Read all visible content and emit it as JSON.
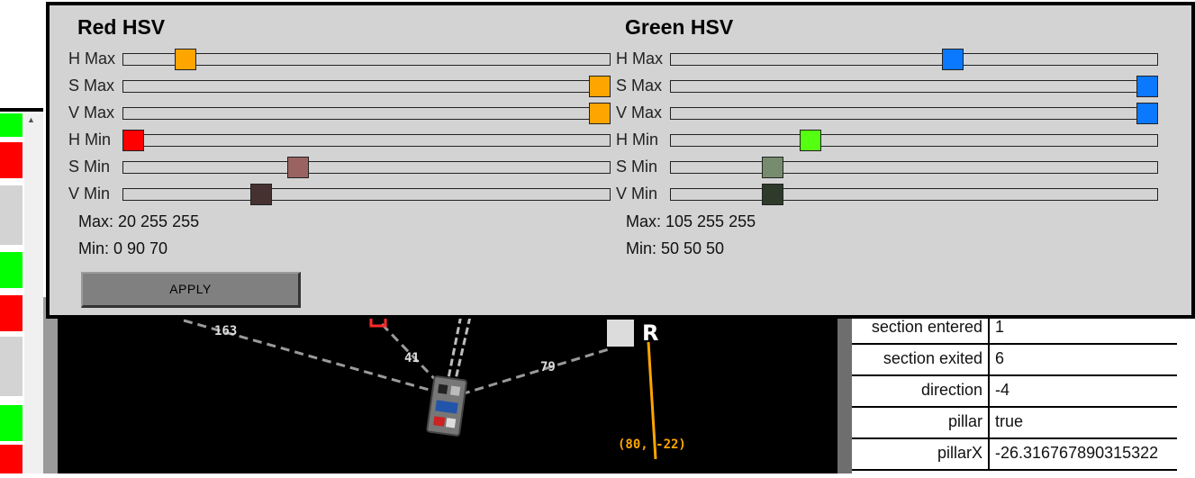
{
  "hsv_panel": {
    "groups": [
      {
        "title": "Red HSV",
        "sliders": [
          {
            "label": "H Max",
            "value": 20,
            "max": 180,
            "color": "#FFA500"
          },
          {
            "label": "S Max",
            "value": 255,
            "max": 255,
            "color": "#FFA500"
          },
          {
            "label": "V Max",
            "value": 255,
            "max": 255,
            "color": "#FFA500"
          },
          {
            "label": "H Min",
            "value": 0,
            "max": 180,
            "color": "#FF0000"
          },
          {
            "label": "S Min",
            "value": 90,
            "max": 255,
            "color": "#9B6262"
          },
          {
            "label": "V Min",
            "value": 70,
            "max": 255,
            "color": "#463131"
          }
        ],
        "max_text": "Max: 20 255 255",
        "min_text": "Min: 0 90 70"
      },
      {
        "title": "Green HSV",
        "sliders": [
          {
            "label": "H Max",
            "value": 105,
            "max": 180,
            "color": "#0A78FF"
          },
          {
            "label": "S Max",
            "value": 255,
            "max": 255,
            "color": "#0A78FF"
          },
          {
            "label": "V Max",
            "value": 255,
            "max": 255,
            "color": "#0A78FF"
          },
          {
            "label": "H Min",
            "value": 50,
            "max": 180,
            "color": "#55FF10"
          },
          {
            "label": "S Min",
            "value": 50,
            "max": 255,
            "color": "#778C6E"
          },
          {
            "label": "V Min",
            "value": 50,
            "max": 255,
            "color": "#2E3A2A"
          }
        ],
        "max_text": "Max: 105 255 255",
        "min_text": "Min: 50 50 50"
      }
    ],
    "apply_label": "APPLY"
  },
  "field": {
    "distances": [
      "163",
      "41",
      "79"
    ],
    "marker_label": "R",
    "coordinate_label": "(80, -22)"
  },
  "telemetry": [
    {
      "key": "section entered",
      "value": "1"
    },
    {
      "key": "section exited",
      "value": "6"
    },
    {
      "key": "direction",
      "value": "-4"
    },
    {
      "key": "pillar",
      "value": "true"
    },
    {
      "key": "pillarX",
      "value": "-26.316767890315322"
    }
  ],
  "left_indicators": [
    "green",
    "red",
    "gray",
    "green",
    "red",
    "gray",
    "green",
    "red"
  ],
  "colors": {
    "green": "#00FF00",
    "red": "#FF0000",
    "gray": "#D3D3D3",
    "path": "#FFA500"
  }
}
